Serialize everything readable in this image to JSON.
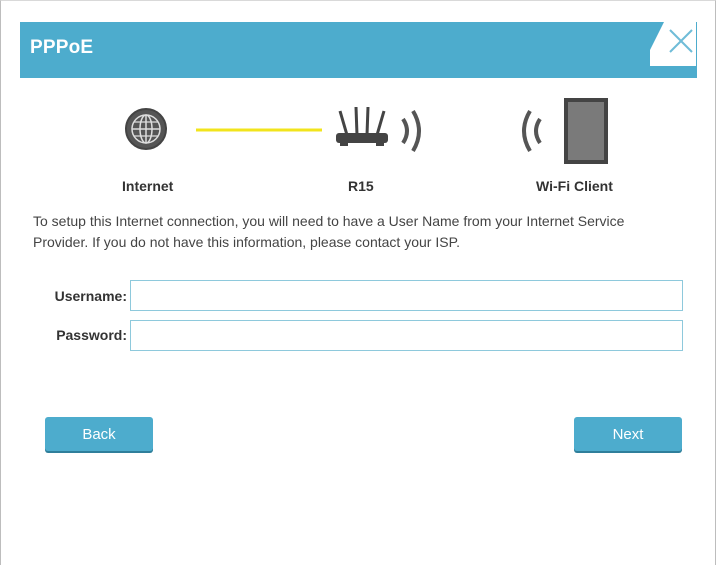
{
  "dialog": {
    "title": "PPPoE"
  },
  "diagram": {
    "internet_label": "Internet",
    "router_label": "R15",
    "client_label": "Wi-Fi Client",
    "link_color": "#f2e41c"
  },
  "description": "To setup this Internet connection, you will need to have a User Name from your Internet Service Provider. If you do not have this information, please contact your ISP.",
  "form": {
    "username_label": "Username:",
    "username_value": "",
    "password_label": "Password:",
    "password_value": ""
  },
  "buttons": {
    "back": "Back",
    "next": "Next"
  },
  "colors": {
    "accent": "#4daccd",
    "icon": "#555555"
  }
}
